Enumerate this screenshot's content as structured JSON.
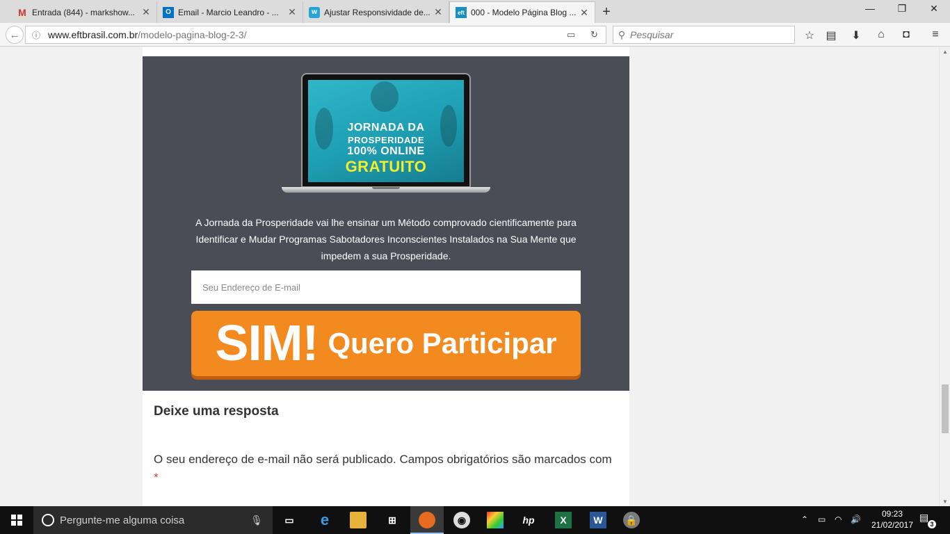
{
  "browser": {
    "tabs": [
      {
        "title": "Entrada (844) - markshow...",
        "icon": "gmail-icon",
        "favicon_text": "M",
        "active": false
      },
      {
        "title": "Email - Marcio Leandro - ...",
        "icon": "outlook-icon",
        "favicon_text": "O",
        "active": false
      },
      {
        "title": "Ajustar Responsividade de...",
        "icon": "workana-icon",
        "favicon_text": "w",
        "active": false
      },
      {
        "title": "000 - Modelo Página Blog ...",
        "icon": "eft-icon",
        "favicon_text": "eft",
        "active": true
      }
    ],
    "new_tab_label": "+",
    "url_host": "www.eftbrasil.com.br",
    "url_path": "/modelo-pagina-blog-2-3/",
    "search_placeholder": "Pesquisar"
  },
  "page": {
    "ebook": {
      "line1": "JORNADA DA",
      "line2": "PROSPERIDADE",
      "line3": "100% ONLINE",
      "line4": "GRATUITO"
    },
    "description": "A Jornada da Prosperidade vai lhe ensinar um Método comprovado cientificamente para Identificar e Mudar Programas Sabotadores Inconscientes Instalados na Sua Mente que impedem a sua Prosperidade.",
    "email_placeholder": "Seu Endereço de E-mail",
    "cta_big": "SIM!",
    "cta_small": "Quero Participar",
    "reply_title": "Deixe uma resposta",
    "reply_note": "O seu endereço de e-mail não será publicado. Campos obrigatórios são marcados com",
    "required_mark": "*"
  },
  "taskbar": {
    "search_placeholder": "Pergunte-me alguma coisa",
    "time": "09:23",
    "date": "21/02/2017",
    "notification_count": "3"
  },
  "colors": {
    "optin_bg": "#4a4c56",
    "cta": "#f28a1f",
    "ebook_accent": "#f4ef2a",
    "required": "#e23a3a"
  }
}
